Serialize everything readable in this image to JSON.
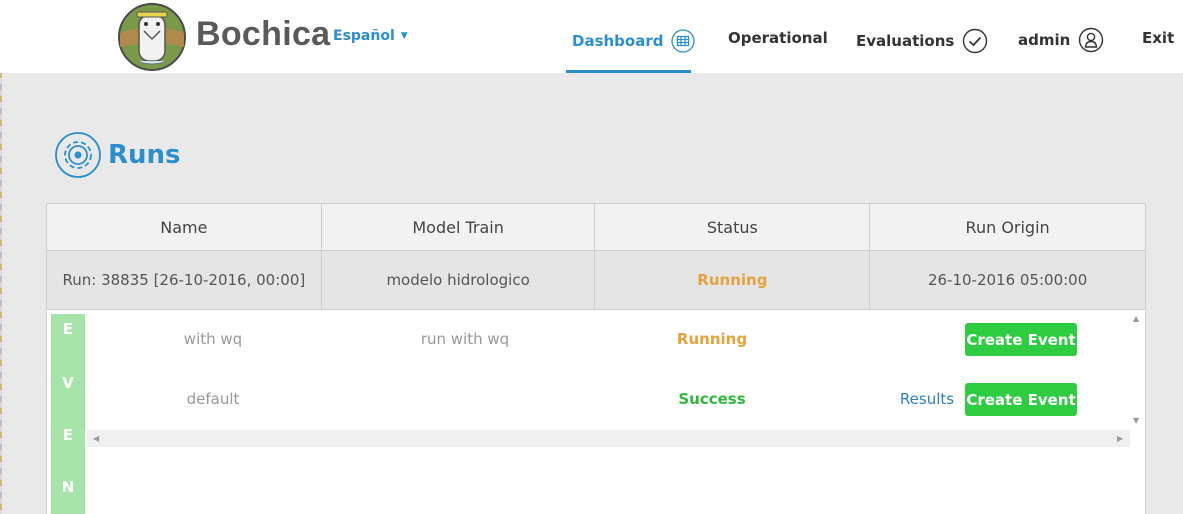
{
  "header": {
    "brand": "Bochica",
    "language": "Español",
    "nav": {
      "dashboard": "Dashboard",
      "operational": "Operational",
      "evaluations": "Evaluations",
      "user": "admin",
      "exit": "Exit"
    }
  },
  "page": {
    "title": "Runs"
  },
  "table": {
    "columns": [
      "Name",
      "Model Train",
      "Status",
      "Run Origin"
    ],
    "rows": [
      {
        "name": "Run: 38835 [26-10-2016, 00:00]",
        "model_train": "modelo hidrologico",
        "status": "Running",
        "run_origin": "26-10-2016 05:00:00"
      }
    ]
  },
  "events": {
    "label_letters": [
      "E",
      "V",
      "E",
      "N"
    ],
    "rows": [
      {
        "name": "with wq",
        "model": "run with wq",
        "status": "Running",
        "results": "",
        "action": "Create Event"
      },
      {
        "name": "default",
        "model": "",
        "status": "Success",
        "results": "Results",
        "action": "Create Event"
      }
    ]
  },
  "colors": {
    "accent": "#2b8fcf",
    "running": "#e6a23c",
    "success": "#2fb83b",
    "button": "#2ecc40",
    "events_label": "#a6e4a9"
  },
  "icons": {
    "dashboard": "table-icon",
    "evaluations": "check-circle-icon",
    "user": "user-icon",
    "runs": "gear-icon"
  }
}
